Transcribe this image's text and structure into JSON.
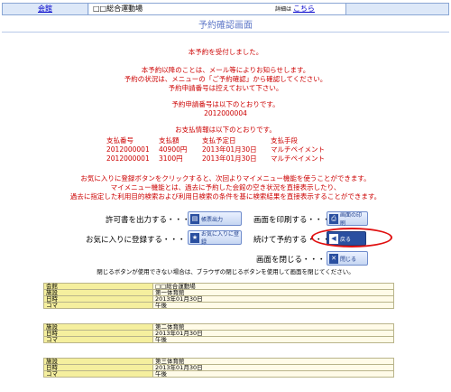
{
  "header": {
    "facility_link": "会館",
    "facility_name": "□□総合運動場",
    "detail_label": "詳細は",
    "detail_link": "こちら"
  },
  "page_title": "予約確認画面",
  "messages": {
    "accepted": "本予約を受付しました。",
    "notice1": "本予約以降のことは、メール等によりお知らせします。",
    "notice2": "予約の状況は、メニューの「ご予約確認」から確認してください。",
    "notice3": "予約申請番号は控えておいて下さい。",
    "app_number_label": "予約申請番号は以下のとおりです。",
    "app_number": "2012000004",
    "payment_label": "お支払情報は以下のとおりです。"
  },
  "payment": {
    "headers": [
      "支払番号",
      "支払額",
      "支払予定日",
      "支払手段"
    ],
    "rows": [
      [
        "2012000001",
        "40900円",
        "2013年01月30日",
        "マルチペイメント"
      ],
      [
        "2012000001",
        "3100円",
        "2013年01月30日",
        "マルチペイメント"
      ]
    ]
  },
  "favorites_notes": {
    "line1": "お気に入りに登録ボタンをクリックすると、次回よりマイメニュー機能を使うことができます。",
    "line2": "マイメニュー機能とは、過去に予約した会館の空き状況を直接表示したり、",
    "line3": "過去に指定した利用目的検索および利用日検索の条件を基に検索結果を直接表示することができます。"
  },
  "actions": {
    "print_permit_label": "許可書を出力する・・・",
    "print_permit_btn": "帳票出力",
    "print_screen_label": "画面を印刷する・・・",
    "print_screen_btn": "画面の印刷",
    "favorite_label": "お気に入りに登録する・・・",
    "favorite_btn": "お気に入りに登録",
    "continue_label": "続けて予約する・・・",
    "continue_btn": "戻る",
    "close_label": "画面を閉じる・・・",
    "close_btn": "閉じる"
  },
  "close_note": "閉じるボタンが使用できない場合は、ブラウザの閉じるボタンを使用して画面を閉じてください。",
  "bookings": [
    {
      "rows": [
        [
          "会館",
          "□□総合運動場"
        ],
        [
          "施設",
          "第一体育館"
        ],
        [
          "日時",
          "2013年01月30日"
        ],
        [
          "コマ",
          "午後"
        ]
      ]
    },
    {
      "rows": [
        [
          "施設",
          "第二体育館"
        ],
        [
          "日時",
          "2013年01月30日"
        ],
        [
          "コマ",
          "午後"
        ]
      ]
    },
    {
      "rows": [
        [
          "施設",
          "第三体育館"
        ],
        [
          "日時",
          "2013年01月30日"
        ],
        [
          "コマ",
          "午後"
        ]
      ]
    }
  ]
}
